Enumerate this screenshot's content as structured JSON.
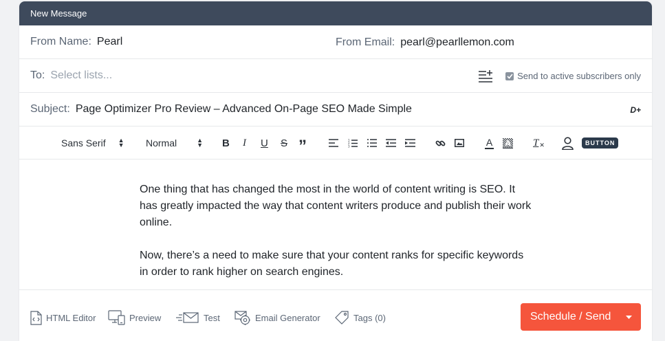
{
  "window": {
    "title": "New Message"
  },
  "from": {
    "name_label": "From Name:",
    "name_value": "Pearl",
    "email_label": "From Email:",
    "email_value": "pearl@pearllemon.com"
  },
  "to": {
    "label": "To:",
    "placeholder": "Select lists...",
    "active_only_label": "Send to active subscribers only",
    "active_only_checked": true
  },
  "subject": {
    "label": "Subject:",
    "value": "Page Optimizer Pro Review – Advanced On-Page SEO Made Simple",
    "dplus": "D+"
  },
  "toolbar": {
    "font_select": "Sans Serif",
    "size_select": "Normal",
    "bold": "B",
    "italic": "I",
    "underline": "U",
    "strike": "S",
    "quote": "”",
    "text_color": "A",
    "clear_format": "T",
    "button_label": "BUTTON"
  },
  "editor": {
    "paragraphs": [
      "One thing that has changed the most in the world of content writing is SEO. It has greatly impacted the way that content writers produce and publish their work online.",
      "Now, there’s a need to make sure that your content ranks for specific keywords in order to rank higher on search engines."
    ]
  },
  "footer": {
    "html_editor": "HTML Editor",
    "preview": "Preview",
    "test": "Test",
    "email_generator": "Email Generator",
    "tags": "Tags (0)",
    "send_label": "Schedule / Send"
  },
  "colors": {
    "titlebar": "#3e4a5c",
    "send_button": "#f5553c",
    "label": "#5b6675"
  }
}
